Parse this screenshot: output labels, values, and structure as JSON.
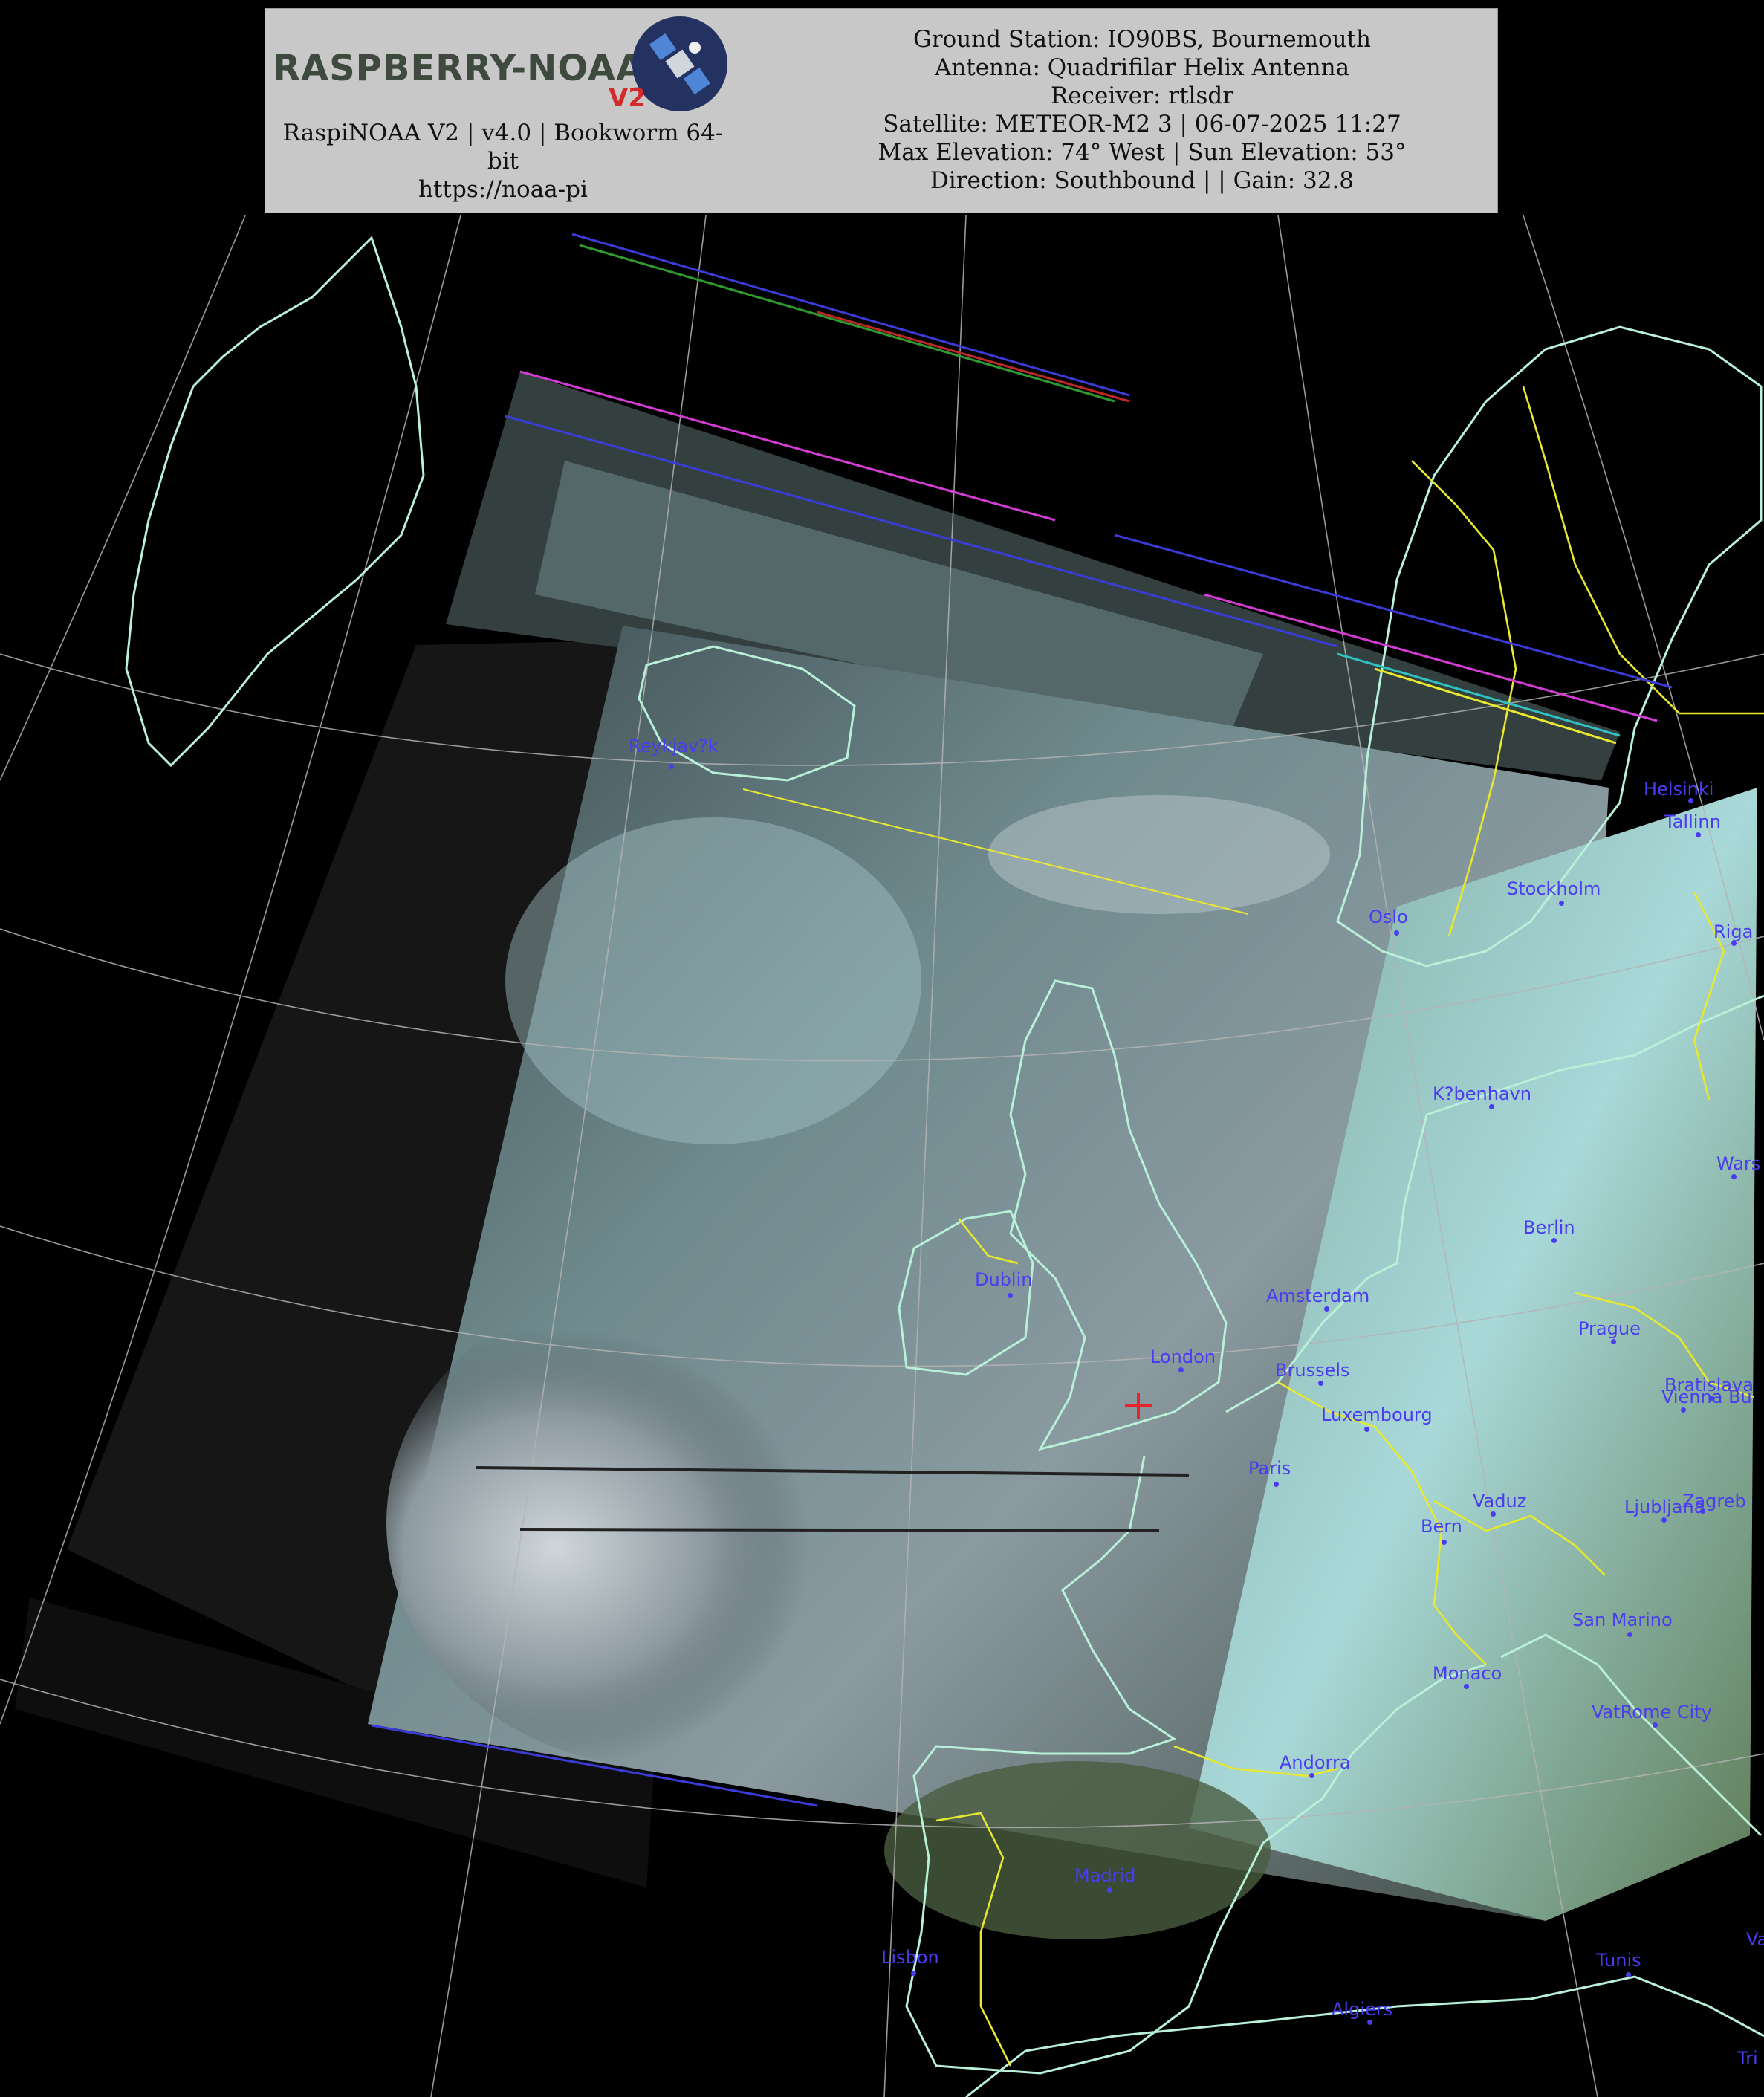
{
  "header": {
    "logo_text": "RASPBERRY-NOAA",
    "logo_suffix": "V2",
    "software_line_1": "RaspiNOAA V2 | v4.0 | Bookworm 64-",
    "software_line_2": "bit",
    "url": "https://noaa-pi",
    "ground_station": "Ground Station: IO90BS, Bournemouth",
    "antenna": "Antenna: Quadrifilar Helix Antenna",
    "receiver": "Receiver: rtlsdr",
    "satellite": "Satellite: METEOR-M2 3 | 06-07-2025 11:27",
    "elevation": "Max Elevation: 74° West | Sun Elevation: 53°",
    "direction": "Direction: Southbound | | Gain: 32.8"
  },
  "colors": {
    "coastline": "#b8f0d8",
    "border": "#e8e830",
    "graticule": "#b4b4b4",
    "city_label": "#4a3cf0",
    "station_marker": "#e8232a",
    "header_bg": "#c8c8c8"
  },
  "icons": {
    "logo": "satellite-icon",
    "station": "crosshair-icon"
  },
  "cities": [
    {
      "id": "reykjavik",
      "label": "Reykjav?k"
    },
    {
      "id": "helsinki",
      "label": "Helsinki"
    },
    {
      "id": "tallinn",
      "label": "Tallinn"
    },
    {
      "id": "stockholm",
      "label": "Stockholm"
    },
    {
      "id": "oslo",
      "label": "Oslo"
    },
    {
      "id": "riga",
      "label": "Riga"
    },
    {
      "id": "kobenhavn",
      "label": "K?benhavn"
    },
    {
      "id": "warsaw",
      "label": "Wars"
    },
    {
      "id": "berlin",
      "label": "Berlin"
    },
    {
      "id": "dublin",
      "label": "Dublin"
    },
    {
      "id": "amsterdam",
      "label": "Amsterdam"
    },
    {
      "id": "prague",
      "label": "Prague"
    },
    {
      "id": "london",
      "label": "London"
    },
    {
      "id": "brussels",
      "label": "Brussels"
    },
    {
      "id": "bratislava",
      "label": "Bratislava"
    },
    {
      "id": "vienna",
      "label": "Vienna Bu"
    },
    {
      "id": "luxembourg",
      "label": "Luxembourg"
    },
    {
      "id": "paris",
      "label": "Paris"
    },
    {
      "id": "vaduz",
      "label": "Vaduz"
    },
    {
      "id": "ljubljana",
      "label": "Ljubljana"
    },
    {
      "id": "zagreb",
      "label": "Zagreb"
    },
    {
      "id": "bern",
      "label": "Bern"
    },
    {
      "id": "sanmarino",
      "label": "San Marino"
    },
    {
      "id": "monaco",
      "label": "Monaco"
    },
    {
      "id": "vatican",
      "label": "VatRome City"
    },
    {
      "id": "andorra",
      "label": "Andorra"
    },
    {
      "id": "madrid",
      "label": "Madrid"
    },
    {
      "id": "lisbon",
      "label": "Lisbon"
    },
    {
      "id": "tunis",
      "label": "Tunis"
    },
    {
      "id": "algiers",
      "label": "Algiers"
    },
    {
      "id": "valletta",
      "label": "Va"
    },
    {
      "id": "tripoli",
      "label": "Tri"
    }
  ]
}
